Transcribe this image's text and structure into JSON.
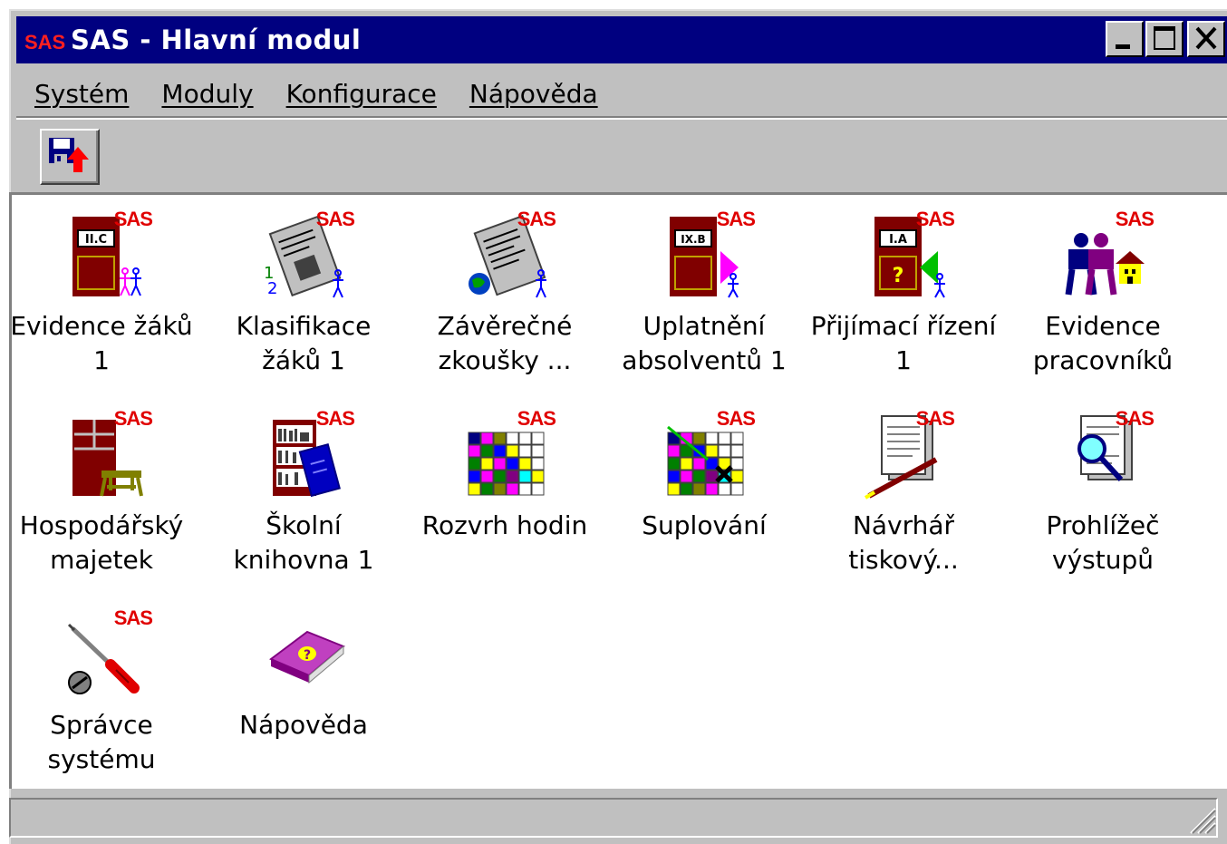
{
  "window": {
    "title": "SAS - Hlavní modul",
    "logo_text": "SAS",
    "controls": [
      "minimize",
      "maximize",
      "close"
    ]
  },
  "menu": {
    "items": [
      {
        "label": "Systém"
      },
      {
        "label": "Moduly"
      },
      {
        "label": "Konfigurace"
      },
      {
        "label": "Nápověda"
      }
    ]
  },
  "toolbar": {
    "buttons": [
      {
        "icon": "save-exit-icon"
      }
    ]
  },
  "icons": [
    {
      "label": "Evidence žáků 1",
      "icon": "classroom-door-students-icon",
      "sas": "SAS",
      "door_label": "II.C"
    },
    {
      "label": "Klasifikace žáků 1",
      "icon": "grades-document-icon",
      "sas": "SAS"
    },
    {
      "label": "Závěrečné zkoušky ...",
      "icon": "exam-document-globe-icon",
      "sas": "SAS"
    },
    {
      "label": "Uplatnění absolventů 1",
      "icon": "graduates-exit-icon",
      "sas": "SAS",
      "door_label": "IX.B"
    },
    {
      "label": "Přijímací řízení 1",
      "icon": "admission-door-icon",
      "sas": "SAS",
      "door_label": "I.A"
    },
    {
      "label": "Evidence pracovníků",
      "icon": "staff-house-icon",
      "sas": "SAS"
    },
    {
      "label": "Hospodářský majetek",
      "icon": "property-furniture-icon",
      "sas": "SAS"
    },
    {
      "label": "Školní knihovna 1",
      "icon": "library-bookshelf-icon",
      "sas": "SAS"
    },
    {
      "label": "Rozvrh hodin",
      "icon": "timetable-grid-icon",
      "sas": "SAS"
    },
    {
      "label": "Suplování",
      "icon": "substitution-grid-icon",
      "sas": "SAS"
    },
    {
      "label": "Návrhář tiskový...",
      "icon": "report-designer-pen-icon",
      "sas": "SAS"
    },
    {
      "label": "Prohlížeč výstupů",
      "icon": "output-viewer-magnifier-icon",
      "sas": "SAS"
    },
    {
      "label": "Správce systému",
      "icon": "admin-screwdriver-icon",
      "sas": "SAS"
    },
    {
      "label": "Nápověda",
      "icon": "help-book-icon",
      "sas": ""
    }
  ]
}
